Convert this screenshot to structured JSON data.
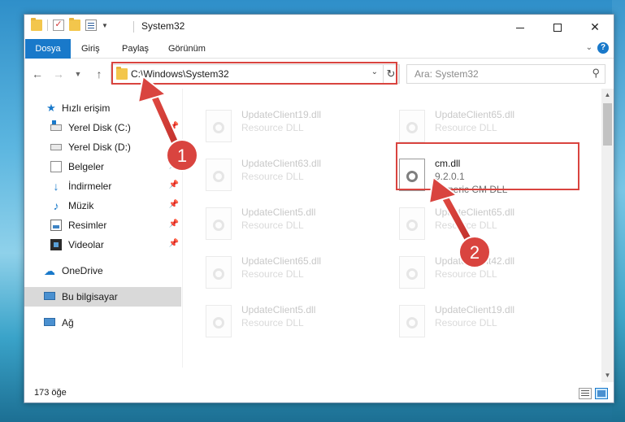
{
  "window": {
    "title": "System32"
  },
  "ribbon": {
    "tabs": [
      "Dosya",
      "Giriş",
      "Paylaş",
      "Görünüm"
    ]
  },
  "nav": {
    "address": "C:\\Windows\\System32",
    "search_placeholder": "Ara: System32"
  },
  "sidebar": {
    "items": [
      {
        "label": "Hızlı erişim",
        "icon": "star-icon"
      },
      {
        "label": "Yerel Disk (C:)",
        "icon": "drive-icon"
      },
      {
        "label": "Yerel Disk (D:)",
        "icon": "drive-icon"
      },
      {
        "label": "Belgeler",
        "icon": "documents-icon"
      },
      {
        "label": "İndirmeler",
        "icon": "downloads-icon"
      },
      {
        "label": "Müzik",
        "icon": "music-icon"
      },
      {
        "label": "Resimler",
        "icon": "pictures-icon"
      },
      {
        "label": "Videolar",
        "icon": "videos-icon"
      },
      {
        "label": "OneDrive",
        "icon": "cloud-icon"
      },
      {
        "label": "Bu bilgisayar",
        "icon": "computer-icon"
      },
      {
        "label": "Ağ",
        "icon": "network-icon"
      }
    ]
  },
  "files": [
    {
      "name": "UpdateClient19.dll",
      "desc": "Resource DLL"
    },
    {
      "name": "UpdateClient65.dll",
      "desc": "Resource DLL"
    },
    {
      "name": "UpdateClient63.dll",
      "desc": "Resource DLL"
    },
    {
      "name": "cm.dll",
      "version": "9.2.0.1",
      "desc": "Generic CM DLL"
    },
    {
      "name": "UpdateClient5.dll",
      "desc": "Resource DLL"
    },
    {
      "name": "UpdateClient65.dll",
      "desc": "Resource DLL"
    },
    {
      "name": "UpdateClient65.dll",
      "desc": "Resource DLL"
    },
    {
      "name": "UpdateClient42.dll",
      "desc": "Resource DLL"
    },
    {
      "name": "UpdateClient5.dll",
      "desc": "Resource DLL"
    },
    {
      "name": "UpdateClient19.dll",
      "desc": "Resource DLL"
    }
  ],
  "status": {
    "count": "173 öğe"
  },
  "callouts": {
    "one": "1",
    "two": "2"
  },
  "colors": {
    "accent": "#1979ca",
    "highlight": "#d9443f",
    "badge": "#d9443f"
  }
}
